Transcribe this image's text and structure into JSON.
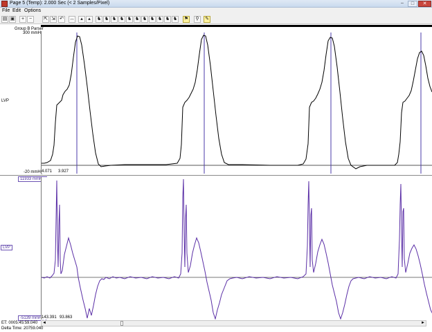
{
  "window": {
    "title": "Page 5 (Temp): 2.000 Sec   (< 2 Samples/Pixel)",
    "min_glyph": "–",
    "max_glyph": "□",
    "close_glyph": "✕"
  },
  "menu": [
    "File",
    "Edit",
    "Options"
  ],
  "toolbar": {
    "buttons": [
      "print-icon",
      "save-icon",
      "zoom-in-icon",
      "zoom-out-icon",
      "expand-icon",
      "compress-icon",
      "undo-icon",
      "horizontal-arrows-icon",
      "marker-icon",
      "marker-icon",
      "marker-icon",
      "marker-icon",
      "marker-icon",
      "marker-icon",
      "marker-icon",
      "marker-icon",
      "marker-icon",
      "marker-icon",
      "marker-icon",
      "marker-icon",
      "marker-icon",
      "marker-icon",
      "flag-icon",
      "probe-icon",
      "pen-icon"
    ]
  },
  "channels": {
    "group_label": "Group B Parser",
    "ch1": {
      "name": "LVP",
      "scale_top": "300 mmHg",
      "scale_bottom": "-20 mmHg",
      "readout_a": "4.071",
      "readout_b": "3.927",
      "color": "#000000"
    },
    "ch2": {
      "name": "LVP",
      "scale_top": "11933 mmHg",
      "scale_bottom": "-5139 mmHg",
      "readout_a": "143.391",
      "readout_b": "93.863",
      "color": "#5a2ea6"
    }
  },
  "status": {
    "et": "ET: 0005:45:59.040",
    "delta": "Delta Time: 20759.040"
  },
  "scroll": {
    "left": "◄",
    "right": "►"
  }
}
